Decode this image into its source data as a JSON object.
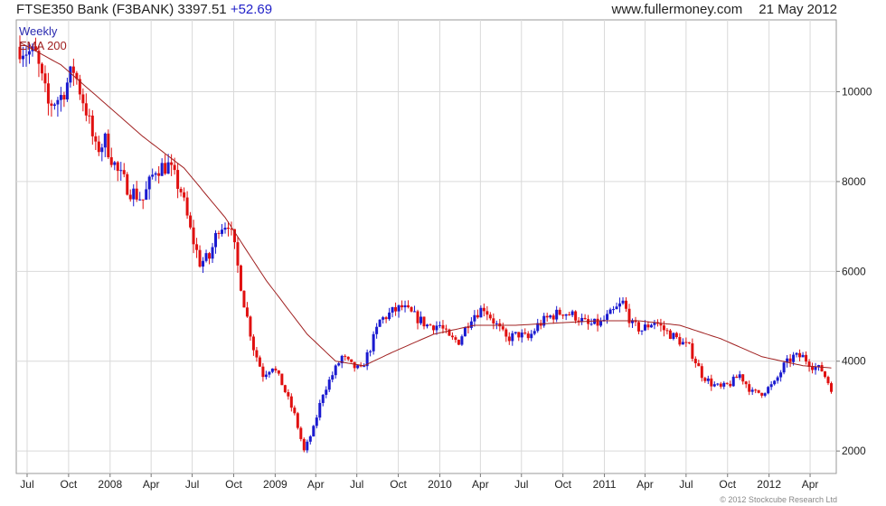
{
  "header": {
    "title": "FTSE350 Bank (F3BANK)",
    "last": "3397.51",
    "change": "+52.69",
    "site": "www.fullermoney.com",
    "date": "21 May 2012"
  },
  "legend": {
    "weekly": "Weekly",
    "ema": "EMA 200"
  },
  "copyright": "© 2012 Stockcube Research Ltd",
  "colors": {
    "up": "#1a1ad0",
    "down": "#e01010",
    "ema": "#a02020",
    "grid": "#d9d9d9",
    "weekly_text": "#2a2ab0",
    "ema_text": "#a02020"
  },
  "chart_data": {
    "type": "candlestick",
    "frequency": "weekly",
    "x_range": [
      "2007-06-15",
      "2012-05-21"
    ],
    "ylim": [
      1500,
      11600
    ],
    "y_ticks": [
      2000,
      4000,
      6000,
      8000,
      10000
    ],
    "y_tick_labels": [
      "2000",
      "4000",
      "6000",
      "8000",
      "10000"
    ],
    "x_ticks": [
      "2007-07-01",
      "2007-10-01",
      "2008-01-01",
      "2008-04-01",
      "2008-07-01",
      "2008-10-01",
      "2009-01-01",
      "2009-04-01",
      "2009-07-01",
      "2009-10-01",
      "2010-01-01",
      "2010-04-01",
      "2010-07-01",
      "2010-10-01",
      "2011-01-01",
      "2011-04-01",
      "2011-07-01",
      "2011-10-01",
      "2012-01-01",
      "2012-04-01"
    ],
    "x_tick_labels": [
      "Jul",
      "Oct",
      "2008",
      "Apr",
      "Jul",
      "Oct",
      "2009",
      "Apr",
      "Jul",
      "Oct",
      "2010",
      "Apr",
      "Jul",
      "Oct",
      "2011",
      "Apr",
      "Jul",
      "Oct",
      "2012",
      "Apr"
    ],
    "grid": true,
    "y_axis_side": "right",
    "close_anchors": [
      [
        "2007-06-15",
        11000
      ],
      [
        "2007-07-20",
        10800
      ],
      [
        "2007-08-17",
        9700
      ],
      [
        "2007-09-14",
        9900
      ],
      [
        "2007-10-12",
        10500
      ],
      [
        "2007-11-09",
        9600
      ],
      [
        "2007-11-30",
        8700
      ],
      [
        "2007-12-21",
        8900
      ],
      [
        "2008-01-18",
        8200
      ],
      [
        "2008-02-15",
        7800
      ],
      [
        "2008-03-14",
        7600
      ],
      [
        "2008-04-11",
        8300
      ],
      [
        "2008-05-09",
        8350
      ],
      [
        "2008-06-06",
        7800
      ],
      [
        "2008-06-27",
        6900
      ],
      [
        "2008-07-18",
        6200
      ],
      [
        "2008-08-08",
        6300
      ],
      [
        "2008-08-29",
        7000
      ],
      [
        "2008-09-19",
        7100
      ],
      [
        "2008-10-03",
        6500
      ],
      [
        "2008-10-24",
        5300
      ],
      [
        "2008-11-14",
        4300
      ],
      [
        "2008-12-05",
        3700
      ],
      [
        "2008-12-26",
        3900
      ],
      [
        "2009-01-16",
        3500
      ],
      [
        "2009-02-13",
        2800
      ],
      [
        "2009-03-06",
        2000
      ],
      [
        "2009-03-27",
        2500
      ],
      [
        "2009-04-17",
        3300
      ],
      [
        "2009-05-08",
        3700
      ],
      [
        "2009-05-29",
        4100
      ],
      [
        "2009-06-19",
        3900
      ],
      [
        "2009-07-10",
        3800
      ],
      [
        "2009-07-31",
        4300
      ],
      [
        "2009-08-21",
        4900
      ],
      [
        "2009-09-18",
        5100
      ],
      [
        "2009-10-09",
        5200
      ],
      [
        "2009-11-06",
        5000
      ],
      [
        "2009-12-04",
        4800
      ],
      [
        "2010-01-01",
        4800
      ],
      [
        "2010-01-22",
        4500
      ],
      [
        "2010-02-12",
        4450
      ],
      [
        "2010-03-12",
        5000
      ],
      [
        "2010-04-09",
        5200
      ],
      [
        "2010-05-07",
        4800
      ],
      [
        "2010-05-28",
        4500
      ],
      [
        "2010-06-25",
        4600
      ],
      [
        "2010-07-16",
        4500
      ],
      [
        "2010-08-06",
        4800
      ],
      [
        "2010-09-03",
        5000
      ],
      [
        "2010-10-01",
        5100
      ],
      [
        "2010-10-29",
        5000
      ],
      [
        "2010-11-26",
        4800
      ],
      [
        "2010-12-24",
        4850
      ],
      [
        "2011-01-21",
        5100
      ],
      [
        "2011-02-11",
        5300
      ],
      [
        "2011-03-04",
        4800
      ],
      [
        "2011-03-25",
        4700
      ],
      [
        "2011-04-22",
        4900
      ],
      [
        "2011-05-13",
        4700
      ],
      [
        "2011-06-10",
        4500
      ],
      [
        "2011-07-08",
        4300
      ],
      [
        "2011-08-05",
        3700
      ],
      [
        "2011-08-26",
        3500
      ],
      [
        "2011-09-16",
        3400
      ],
      [
        "2011-10-07",
        3500
      ],
      [
        "2011-10-28",
        3700
      ],
      [
        "2011-11-25",
        3300
      ],
      [
        "2011-12-16",
        3300
      ],
      [
        "2012-01-13",
        3500
      ],
      [
        "2012-02-03",
        3900
      ],
      [
        "2012-02-24",
        4100
      ],
      [
        "2012-03-16",
        4100
      ],
      [
        "2012-04-06",
        3900
      ],
      [
        "2012-04-27",
        3800
      ],
      [
        "2012-05-18",
        3400
      ]
    ],
    "ema_anchors": [
      [
        "2007-06-15",
        11100
      ],
      [
        "2007-09-14",
        10600
      ],
      [
        "2007-12-14",
        9800
      ],
      [
        "2008-03-14",
        9000
      ],
      [
        "2008-06-13",
        8300
      ],
      [
        "2008-09-12",
        7200
      ],
      [
        "2008-12-12",
        5800
      ],
      [
        "2009-03-13",
        4600
      ],
      [
        "2009-05-15",
        4000
      ],
      [
        "2009-07-17",
        3900
      ],
      [
        "2009-09-18",
        4200
      ],
      [
        "2009-12-18",
        4600
      ],
      [
        "2010-03-19",
        4800
      ],
      [
        "2010-06-18",
        4800
      ],
      [
        "2010-09-17",
        4850
      ],
      [
        "2010-12-17",
        4900
      ],
      [
        "2011-03-18",
        4900
      ],
      [
        "2011-06-17",
        4800
      ],
      [
        "2011-09-16",
        4500
      ],
      [
        "2011-12-16",
        4100
      ],
      [
        "2012-03-16",
        3900
      ],
      [
        "2012-05-18",
        3850
      ]
    ],
    "last_value": 3397.51,
    "change": 52.69
  }
}
